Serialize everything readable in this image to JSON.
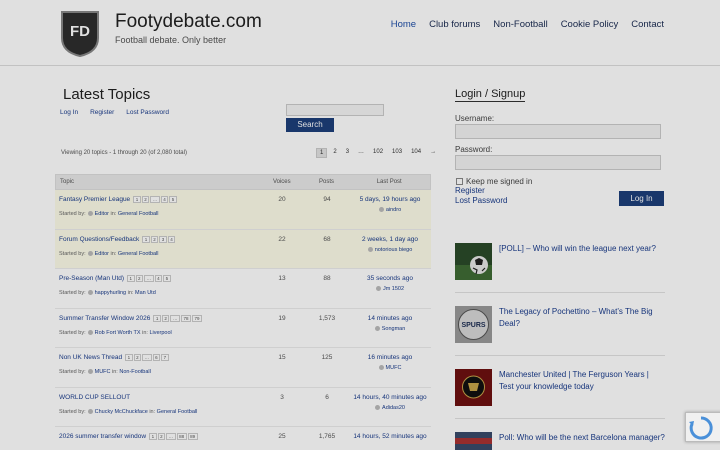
{
  "site": {
    "title": "Footydebate.com",
    "tagline": "Football debate. Only better",
    "logo_text": "FD"
  },
  "nav": [
    "Home",
    "Club forums",
    "Non-Football",
    "Cookie Policy",
    "Contact"
  ],
  "main": {
    "title": "Latest Topics",
    "links": [
      "Log In",
      "Register",
      "Lost Password"
    ],
    "search_button": "Search",
    "viewing": "Viewing 20 topics - 1 through 20 (of 2,080 total)",
    "pager": [
      "1",
      "2",
      "3",
      "…",
      "102",
      "103",
      "104",
      "→"
    ],
    "columns": [
      "Topic",
      "Voices",
      "Posts",
      "Last Post"
    ],
    "topics": [
      {
        "title": "Fantasy Premier League",
        "pages": [
          "1",
          "2",
          "…",
          "4",
          "5"
        ],
        "started_by": "Started by:",
        "author": "Editor",
        "in": "in:",
        "forum": "General Football",
        "voices": "20",
        "posts": "94",
        "last_time": "5 days, 19 hours ago",
        "last_user": "aindro",
        "sticky": true
      },
      {
        "title": "Forum Questions/Feedback",
        "pages": [
          "1",
          "2",
          "3",
          "4"
        ],
        "started_by": "Started by:",
        "author": "Editor",
        "in": "in:",
        "forum": "General Football",
        "voices": "22",
        "posts": "68",
        "last_time": "2 weeks, 1 day ago",
        "last_user": "notorious biego",
        "sticky": true
      },
      {
        "title": "Pre-Season (Man Utd)",
        "pages": [
          "1",
          "2",
          "…",
          "4",
          "5"
        ],
        "started_by": "Started by:",
        "author": "happyhurling",
        "in": "in:",
        "forum": "Man Utd",
        "voices": "13",
        "posts": "88",
        "last_time": "35 seconds ago",
        "last_user": "Jm 1502",
        "sticky": false
      },
      {
        "title": "Summer Transfer Window 2026",
        "pages": [
          "1",
          "2",
          "…",
          "78",
          "79"
        ],
        "started_by": "Started by:",
        "author": "Rob Fort Worth TX",
        "in": "in:",
        "forum": "Liverpool",
        "voices": "19",
        "posts": "1,573",
        "last_time": "14 minutes ago",
        "last_user": "Songman",
        "sticky": false
      },
      {
        "title": "Non UK News Thread",
        "pages": [
          "1",
          "2",
          "…",
          "6",
          "7"
        ],
        "started_by": "Started by:",
        "author": "MUFC",
        "in": "in:",
        "forum": "Non-Football",
        "voices": "15",
        "posts": "125",
        "last_time": "16 minutes ago",
        "last_user": "MUFC",
        "sticky": false
      },
      {
        "title": "WORLD CUP SELLOUT",
        "pages": [],
        "started_by": "Started by:",
        "author": "Chucky McChuckface",
        "in": "in:",
        "forum": "General Football",
        "voices": "3",
        "posts": "6",
        "last_time": "14 hours, 40 minutes ago",
        "last_user": "Adidas20",
        "sticky": false
      },
      {
        "title": "2026 summer transfer window",
        "pages": [
          "1",
          "2",
          "…",
          "88",
          "89"
        ],
        "started_by": "",
        "author": "",
        "in": "",
        "forum": "",
        "voices": "25",
        "posts": "1,765",
        "last_time": "14 hours, 52 minutes ago",
        "last_user": "",
        "sticky": false
      }
    ]
  },
  "sidebar": {
    "title": "Login / Signup",
    "username_label": "Username:",
    "password_label": "Password:",
    "keep_signed": "Keep me signed in",
    "register": "Register",
    "lost_password": "Lost Password",
    "login_button": "Log In",
    "posts": [
      {
        "title": "[POLL] – Who will win the league next year?"
      },
      {
        "title": "The Legacy of Pochettino – What’s The Big Deal?"
      },
      {
        "title": "Manchester United | The Ferguson Years | Test your knowledge today"
      },
      {
        "title": "Poll: Who will be the next Barcelona manager?"
      }
    ]
  },
  "colors": {
    "accent": "#1d3f7a",
    "sticky_row": "#fdfce9",
    "link": "#1a3c8c"
  }
}
